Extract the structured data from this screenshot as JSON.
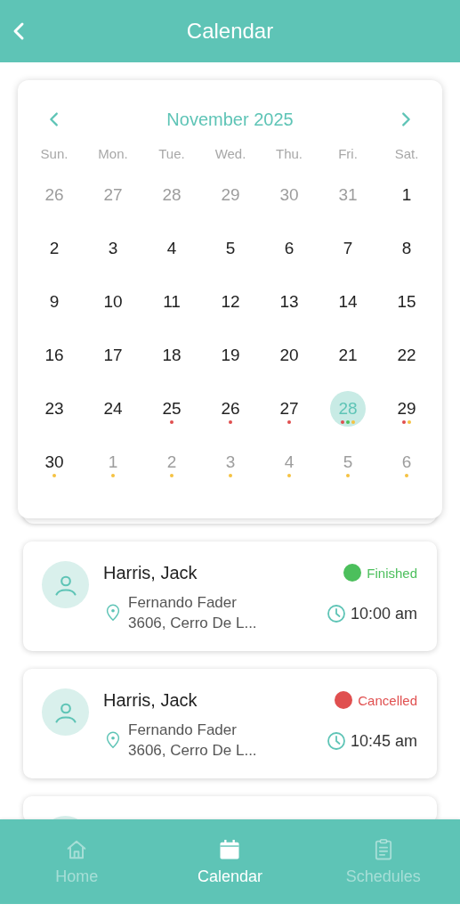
{
  "header": {
    "title": "Calendar"
  },
  "calendar": {
    "month": "November 2025",
    "weekdays": [
      "Sun.",
      "Mon.",
      "Tue.",
      "Wed.",
      "Thu.",
      "Fri.",
      "Sat."
    ],
    "weeks": [
      [
        {
          "day": "26",
          "muted": true,
          "selected": false
        },
        {
          "day": "27",
          "muted": true,
          "selected": false
        },
        {
          "day": "28",
          "muted": true,
          "selected": false
        },
        {
          "day": "29",
          "muted": true,
          "selected": false
        },
        {
          "day": "30",
          "muted": true,
          "selected": false
        },
        {
          "day": "31",
          "muted": true,
          "selected": false
        },
        {
          "day": "1",
          "muted": false,
          "selected": false
        }
      ],
      [
        {
          "day": "2",
          "muted": false,
          "selected": false
        },
        {
          "day": "3",
          "muted": false,
          "selected": false
        },
        {
          "day": "4",
          "muted": false,
          "selected": false
        },
        {
          "day": "5",
          "muted": false,
          "selected": false
        },
        {
          "day": "6",
          "muted": false,
          "selected": false
        },
        {
          "day": "7",
          "muted": false,
          "selected": false
        },
        {
          "day": "8",
          "muted": false,
          "selected": false
        }
      ],
      [
        {
          "day": "9",
          "muted": false,
          "selected": false
        },
        {
          "day": "10",
          "muted": false,
          "selected": false
        },
        {
          "day": "11",
          "muted": false,
          "selected": false
        },
        {
          "day": "12",
          "muted": false,
          "selected": false
        },
        {
          "day": "13",
          "muted": false,
          "selected": false
        },
        {
          "day": "14",
          "muted": false,
          "selected": false
        },
        {
          "day": "15",
          "muted": false,
          "selected": false
        }
      ],
      [
        {
          "day": "16",
          "muted": false,
          "selected": false
        },
        {
          "day": "17",
          "muted": false,
          "selected": false
        },
        {
          "day": "18",
          "muted": false,
          "selected": false
        },
        {
          "day": "19",
          "muted": false,
          "selected": false
        },
        {
          "day": "20",
          "muted": false,
          "selected": false
        },
        {
          "day": "21",
          "muted": false,
          "selected": false
        },
        {
          "day": "22",
          "muted": false,
          "selected": false
        }
      ],
      [
        {
          "day": "23",
          "muted": false,
          "selected": false
        },
        {
          "day": "24",
          "muted": false,
          "selected": false
        },
        {
          "day": "25",
          "muted": false,
          "selected": false,
          "dots": [
            {
              "color": "#e04f4f"
            }
          ]
        },
        {
          "day": "26",
          "muted": false,
          "selected": false,
          "dots": [
            {
              "color": "#e04f4f"
            }
          ]
        },
        {
          "day": "27",
          "muted": false,
          "selected": false,
          "dots": [
            {
              "color": "#e04f4f"
            }
          ]
        },
        {
          "day": "28",
          "muted": false,
          "selected": true,
          "dots": [
            {
              "color": "#e04f4f"
            },
            {
              "color": "#4cbf5c"
            },
            {
              "color": "#f5c242"
            }
          ]
        },
        {
          "day": "29",
          "muted": false,
          "selected": false,
          "dots": [
            {
              "color": "#e04f4f"
            },
            {
              "color": "#f5c242"
            }
          ]
        }
      ],
      [
        {
          "day": "30",
          "muted": false,
          "selected": false,
          "dots": [
            {
              "color": "#f5c242"
            }
          ]
        },
        {
          "day": "1",
          "muted": true,
          "selected": false,
          "dots": [
            {
              "color": "#f5c242"
            }
          ]
        },
        {
          "day": "2",
          "muted": true,
          "selected": false,
          "dots": [
            {
              "color": "#f5c242"
            }
          ]
        },
        {
          "day": "3",
          "muted": true,
          "selected": false,
          "dots": [
            {
              "color": "#f5c242"
            }
          ]
        },
        {
          "day": "4",
          "muted": true,
          "selected": false,
          "dots": [
            {
              "color": "#f5c242"
            }
          ]
        },
        {
          "day": "5",
          "muted": true,
          "selected": false,
          "dots": [
            {
              "color": "#f5c242"
            }
          ]
        },
        {
          "day": "6",
          "muted": true,
          "selected": false,
          "dots": [
            {
              "color": "#f5c242"
            }
          ]
        }
      ]
    ]
  },
  "appointments": [
    {
      "name": "Harris, Jack",
      "address_lines": [
        "Fernando Fader",
        "3606, Cerro De L..."
      ],
      "status": "Finished",
      "color": "#4cbf5c",
      "time": "10:00 am"
    },
    {
      "name": "Harris, Jack",
      "address_lines": [
        "Fernando Fader",
        "3606, Cerro De L..."
      ],
      "status": "Cancelled",
      "color": "#e04f4f",
      "time": "10:45 am"
    }
  ],
  "tabs": [
    {
      "label": "Home",
      "selected": false
    },
    {
      "label": "Calendar",
      "selected": true
    },
    {
      "label": "Schedules",
      "selected": false
    }
  ]
}
